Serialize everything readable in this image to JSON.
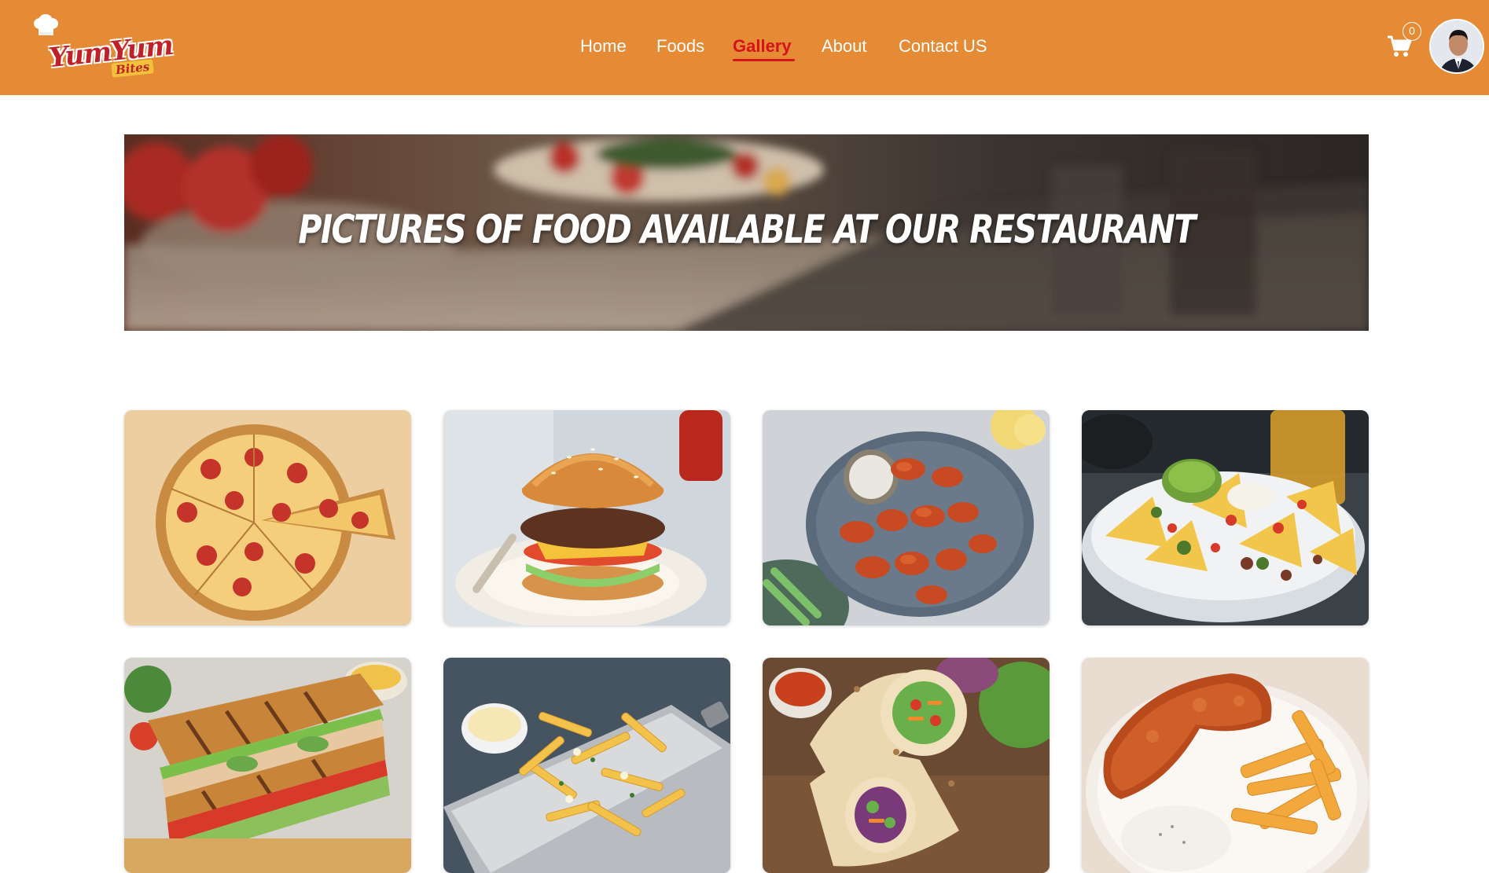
{
  "brand": {
    "logo_main": "YumYum",
    "logo_sub": "Bites"
  },
  "nav": {
    "items": [
      {
        "label": "Home",
        "active": false
      },
      {
        "label": "Foods",
        "active": false
      },
      {
        "label": "Gallery",
        "active": true
      },
      {
        "label": "About",
        "active": false
      },
      {
        "label": "Contact US",
        "active": false
      }
    ],
    "cart_icon": "cart-icon",
    "cart_count": "0",
    "avatar": "user-avatar"
  },
  "banner": {
    "title": "Pictures of food available at our restaurant"
  },
  "gallery": {
    "items": [
      {
        "name": "pizza"
      },
      {
        "name": "burger"
      },
      {
        "name": "chicken-wings"
      },
      {
        "name": "nachos"
      },
      {
        "name": "grilled-sandwich"
      },
      {
        "name": "loaded-fries"
      },
      {
        "name": "wrap"
      },
      {
        "name": "fried-fish-and-chips"
      }
    ]
  },
  "colors": {
    "navbar": "#e58b35",
    "active": "#d6131b",
    "nav_text": "#ffffff"
  }
}
